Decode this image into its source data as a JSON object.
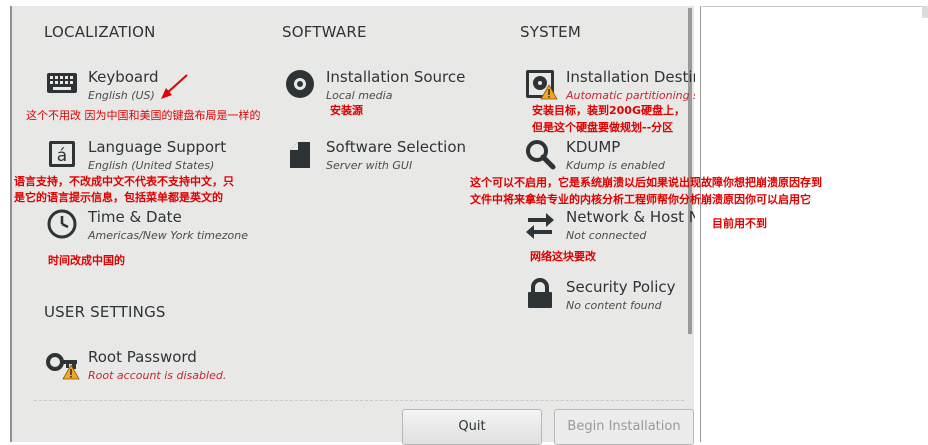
{
  "sections": {
    "localization": "LOCALIZATION",
    "software": "SOFTWARE",
    "system": "SYSTEM",
    "user_settings": "USER SETTINGS"
  },
  "spokes": {
    "keyboard": {
      "title": "Keyboard",
      "status": "English (US)"
    },
    "language": {
      "title": "Language Support",
      "status": "English (United States)"
    },
    "time": {
      "title": "Time & Date",
      "status": "Americas/New York timezone"
    },
    "install_source": {
      "title": "Installation Source",
      "status": "Local media"
    },
    "software_selection": {
      "title": "Software Selection",
      "status": "Server with GUI"
    },
    "install_dest": {
      "title": "Installation Destination",
      "status": "Automatic partitioning selected"
    },
    "kdump": {
      "title": "KDUMP",
      "status": "Kdump is enabled"
    },
    "network": {
      "title": "Network & Host Name",
      "status": "Not connected"
    },
    "security": {
      "title": "Security Policy",
      "status": "No content found"
    },
    "root": {
      "title": "Root Password",
      "status": "Root account is disabled."
    }
  },
  "buttons": {
    "quit": "Quit",
    "begin": "Begin Installation"
  },
  "annotations": {
    "keyboard": "这个不用改 因为中国和美国的键盘布局是一样的",
    "install_source": "安装源",
    "install_dest_1": "安装目标，装到200G硬盘上，",
    "install_dest_2": "但是这个硬盘要做规划--分区",
    "language_1": "语言支持，不改成中文不代表不支持中文，只",
    "language_2": "是它的语言提示信息，包括菜单都是英文的",
    "kdump_1": "这个可以不启用，它是系统崩溃以后如果说出现故障你想把崩溃原因存到",
    "kdump_2": "文件中将来拿给专业的内核分析工程师帮你分析崩溃原因你可以启用它",
    "kdump_3": "目前用不到",
    "time": "时间改成中国的",
    "network": "网络这块要改"
  },
  "colors": {
    "annotation": "#e00000",
    "warning": "#f5a623",
    "text": "#2e3436",
    "error_text": "#c6262e"
  }
}
